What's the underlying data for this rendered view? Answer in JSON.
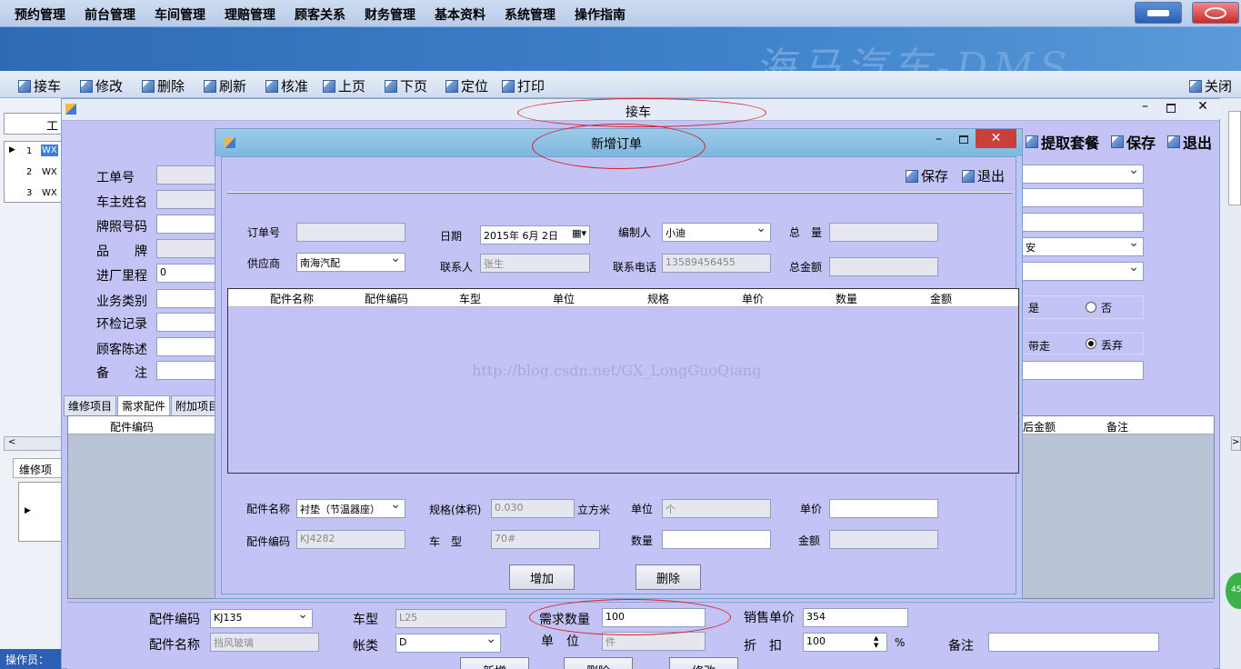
{
  "menu": [
    "预约管理",
    "前台管理",
    "车间管理",
    "理赔管理",
    "顾客关系",
    "财务管理",
    "基本资料",
    "系统管理",
    "操作指南"
  ],
  "banner_text": "海马汽车-DMS",
  "toolbar": {
    "items": [
      "接车",
      "修改",
      "删除",
      "刷新",
      "核准",
      "上页",
      "下页",
      "定位",
      "打印"
    ],
    "close": "关闭"
  },
  "left_grid": {
    "header": "工",
    "rows": [
      {
        "num": "1",
        "val": "WX"
      },
      {
        "num": "2",
        "val": "WX"
      },
      {
        "num": "3",
        "val": "WX"
      }
    ]
  },
  "left_tab": "维修项",
  "jieche": {
    "title": "接车",
    "labels": [
      "工单号",
      "车主姓名",
      "牌照号码",
      "品　　牌",
      "进厂里程",
      "业务类别",
      "环检记录",
      "顾客陈述",
      "备　　注"
    ],
    "mileage": "0",
    "right_buttons": [
      "提取套餐",
      "保存",
      "退出"
    ],
    "right_fields": {
      "combo4": "安"
    },
    "radio_row1": {
      "yes": "是",
      "no": "否"
    },
    "radio_row2": {
      "take": "带走",
      "discard": "丢弃"
    },
    "tabs": [
      "维修项目",
      "需求配件",
      "附加项目"
    ],
    "parts_grid_left_header": "配件编码",
    "parts_grid_right_headers": [
      "后金额",
      "备注"
    ]
  },
  "dialog": {
    "title": "新增订单",
    "save": "保存",
    "exit": "退出",
    "order_no_label": "订单号",
    "date_label": "日期",
    "date_value": "2015年  6月  2日",
    "maker_label": "编制人",
    "maker_value": "小迪",
    "total_qty_label": "总　量",
    "supplier_label": "供应商",
    "supplier_value": "南海汽配",
    "contact_label": "联系人",
    "contact_value": "张生",
    "phone_label": "联系电话",
    "phone_value": "13589456455",
    "total_amount_label": "总金额",
    "grid_headers": [
      "配件名称",
      "配件编码",
      "车型",
      "单位",
      "规格",
      "单价",
      "数量",
      "金额"
    ],
    "watermark": "http://blog.csdn.net/GX_LongGuoQiang",
    "part_name_label": "配件名称",
    "part_name_value": "衬垫（节温器座）",
    "spec_label": "规格(体积)",
    "spec_value": "0.030",
    "spec_unit": "立方米",
    "unit_label": "单位",
    "unit_value": "个",
    "price_label": "单价",
    "part_code_label": "配件编码",
    "part_code_value": "KJ4282",
    "car_type_label": "车　型",
    "car_type_value": "70#",
    "qty_label": "数量",
    "amount_label": "金额",
    "add_button": "增加",
    "delete_button": "删除"
  },
  "bottom": {
    "part_code_label": "配件编码",
    "part_code_value": "KJ135",
    "car_type_label": "车型",
    "car_type_value": "L25",
    "demand_qty_label": "需求数量",
    "demand_qty_value": "100",
    "sale_price_label": "销售单价",
    "sale_price_value": "354",
    "part_name_label": "配件名称",
    "part_name_value": "挡风玻璃",
    "account_label": "帐类",
    "account_value": "D",
    "unit_label": "单　位",
    "unit_value": "件",
    "discount_label": "折　扣",
    "discount_value": "100",
    "percent": "%",
    "remark_label": "备注",
    "buttons": [
      "新增",
      "删除",
      "修改"
    ]
  },
  "status": "操作员：",
  "badge": "45"
}
